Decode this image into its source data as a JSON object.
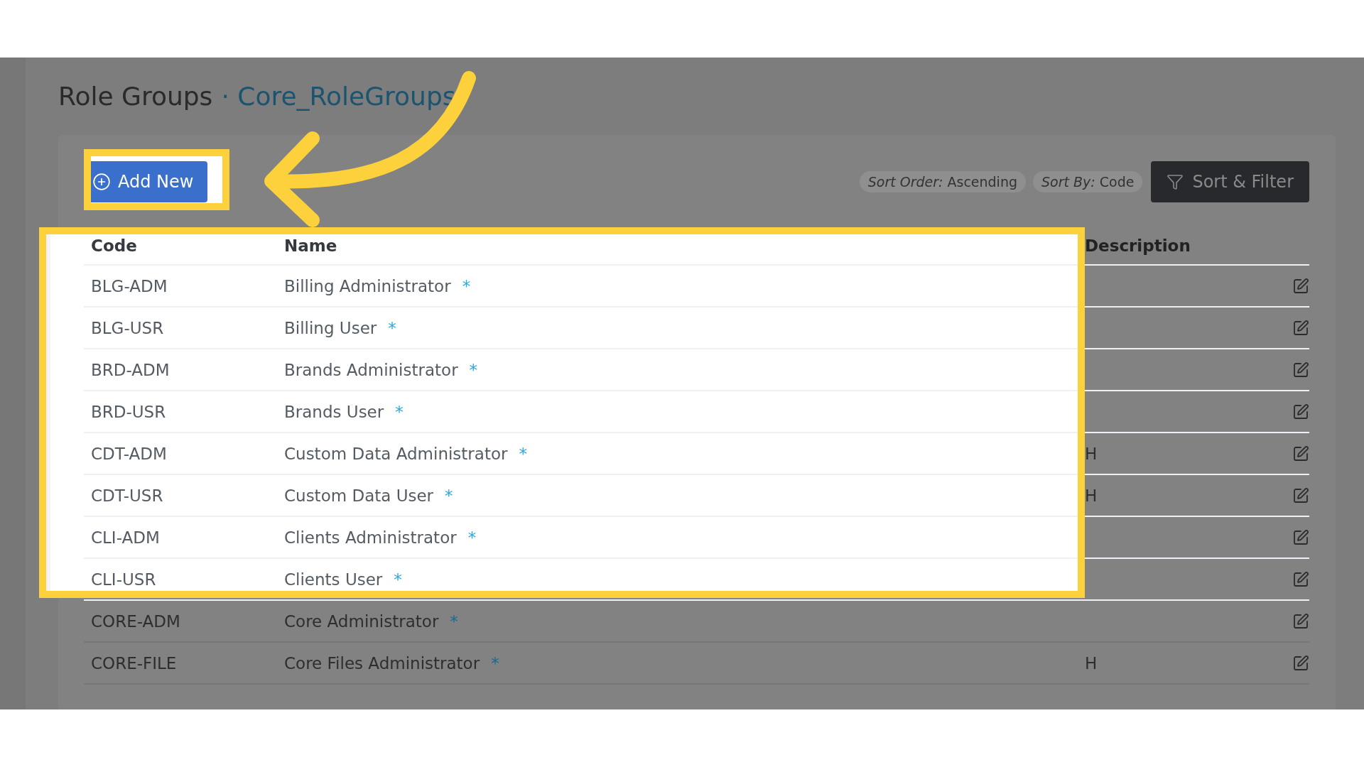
{
  "title": "Role Groups",
  "separator": "·",
  "subtitle": "Core_RoleGroups",
  "add_button": {
    "label": "Add New",
    "highlighted": true
  },
  "sort_chips": [
    {
      "label": "Sort Order:",
      "value": "Ascending"
    },
    {
      "label": "Sort By:",
      "value": "Code"
    }
  ],
  "filter_button": {
    "label": "Sort & Filter"
  },
  "table": {
    "columns": [
      "Code",
      "Name",
      "Description"
    ],
    "header_highlighted": true,
    "rows": [
      {
        "code": "BLG-ADM",
        "name": "Billing Administrator",
        "mark": "*",
        "highlighted": true
      },
      {
        "code": "BLG-USR",
        "name": "Billing User",
        "mark": "*",
        "highlighted": true
      },
      {
        "code": "BRD-ADM",
        "name": "Brands Administrator",
        "mark": "*",
        "highlighted": true
      },
      {
        "code": "BRD-USR",
        "name": "Brands User",
        "mark": "*",
        "highlighted": true
      },
      {
        "code": "CDT-ADM",
        "name": "Custom Data Administrator",
        "mark": "*",
        "description": "H",
        "highlighted": true
      },
      {
        "code": "CDT-USR",
        "name": "Custom Data User",
        "mark": "*",
        "description": "H",
        "highlighted": true
      },
      {
        "code": "CLI-ADM",
        "name": "Clients Administrator",
        "mark": "*",
        "highlighted": true
      },
      {
        "code": "CLI-USR",
        "name": "Clients User",
        "mark": "*",
        "highlighted": true
      },
      {
        "code": "CORE-ADM",
        "name": "Core Administrator",
        "mark": "*",
        "highlighted": false
      },
      {
        "code": "CORE-FILE",
        "name": "Core Files Administrator",
        "mark": "*",
        "description": "H",
        "highlighted": false
      }
    ]
  }
}
